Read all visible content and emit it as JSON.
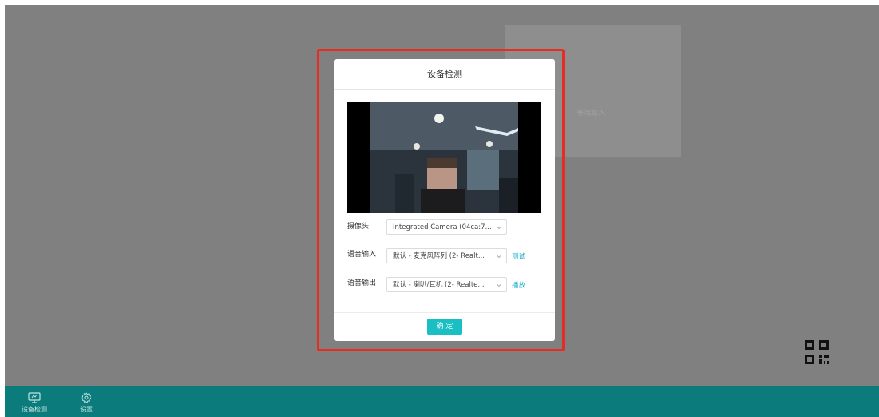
{
  "stage": {
    "waiting_label": "等待加入"
  },
  "dialog": {
    "title": "设备检测",
    "camera": {
      "label": "摄像头",
      "value": "Integrated Camera (04ca:7..."
    },
    "mic": {
      "label": "语音输入",
      "value": "默认 - 麦克风阵列 (2- Realt...",
      "action": "测试"
    },
    "speaker": {
      "label": "语音输出",
      "value": "默认 - 喇叭/耳机 (2- Realte...",
      "action": "播放"
    },
    "confirm_label": "确 定"
  },
  "bottom_bar": {
    "device_check_label": "设备检测",
    "settings_label": "设置"
  },
  "colors": {
    "overlay": "#808080",
    "bottom_bar": "#0b7b7b",
    "accent": "#19bfc2",
    "link": "#1aaecb",
    "highlight": "#e52d23"
  },
  "icons": [
    "qr-code-icon",
    "monitor-icon",
    "gear-icon",
    "chevron-down-icon"
  ]
}
